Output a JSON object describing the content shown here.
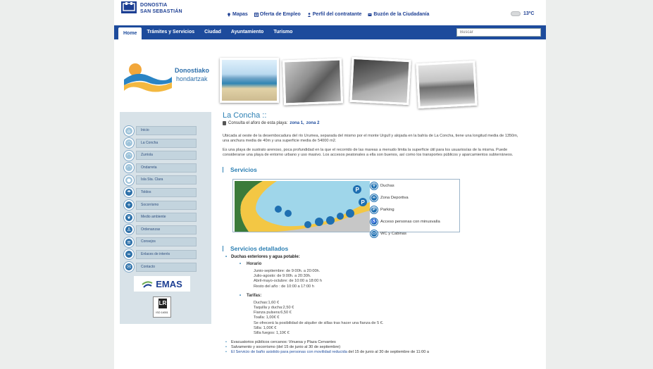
{
  "header": {
    "logo_line1": "DONOSTIA",
    "logo_line2": "SAN SEBASTIÁN",
    "links": [
      {
        "label": "Mapas",
        "icon": "map-pin-icon"
      },
      {
        "label": "Oferta de Empleo",
        "icon": "document-icon"
      },
      {
        "label": "Perfil del contratante",
        "icon": "person-icon"
      },
      {
        "label": "Buzón de la Ciudadanía",
        "icon": "mailbox-icon"
      }
    ],
    "weather": {
      "temp": "13ºC",
      "icon": "cloud-icon"
    }
  },
  "nav": {
    "tabs": [
      "Home",
      "Trámites y Servicios",
      "Ciudad",
      "Ayuntamiento",
      "Turismo"
    ],
    "active_index": 0,
    "search_placeholder": "Buscar"
  },
  "sidebar": {
    "brand_line1": "Donostiako",
    "brand_line2": "hondartzak",
    "menu": [
      {
        "label": "Inicio",
        "icon": "home-icon"
      },
      {
        "label": "La Concha",
        "icon": "beach-icon"
      },
      {
        "label": "Zurriola",
        "icon": "beach-icon"
      },
      {
        "label": "Ondarreta",
        "icon": "beach-icon"
      },
      {
        "label": "Isla Sta. Clara",
        "icon": "island-icon"
      },
      {
        "label": "Toldos",
        "icon": "umbrella-icon"
      },
      {
        "label": "Socorrismo",
        "icon": "cross-icon"
      },
      {
        "label": "Medio ambiente",
        "icon": "leaf-icon"
      },
      {
        "label": "Ordenanzas",
        "icon": "person-icon"
      },
      {
        "label": "Consejos",
        "icon": "list-icon"
      },
      {
        "label": "Enlaces de interés",
        "icon": "link-icon"
      },
      {
        "label": "Contacto",
        "icon": "mail-icon"
      }
    ],
    "emas_label": "EMAS",
    "iso_label": "ISO 14001"
  },
  "content": {
    "title": "La Concha ::",
    "aforo_text": "Consulta el aforo de esta playa:",
    "aforo_links": [
      "zona 1,",
      "zona 2"
    ],
    "para1": "Ubicada al oeste de la desembocadura del río Urumea, separada del mismo por el monte Urgull y alojada en la bahía de La Concha, tiene una longitud media de 1350m, una anchura media de 40m y una superficie media de 54000 m2.",
    "para2": "Es una playa de sustrato arenoso, poca profundidad en la que el recorrido de las mareas a menudo limita la superficie útil para los usuarios/as de la misma. Puede considerarse una playa de entorno urbano y uso masivo. Los accesos peatonales a ella son buenos, así como los transportes públicos y aparcamientos subterráneos.",
    "services_title": "Servicios",
    "legend": [
      {
        "label": "Duchas",
        "glyph": "⚲"
      },
      {
        "label": "Zona Deportiva",
        "glyph": "∞"
      },
      {
        "label": "Parking",
        "glyph": "P"
      },
      {
        "label": "Acceso personas con minusvalía",
        "glyph": "♿"
      },
      {
        "label": "WC y Cabinas",
        "glyph": "▭"
      }
    ],
    "detailed_title": "Servicios detallados",
    "duchas_title": "Duchas exteriores y agua potable:",
    "horario_title": "Horario",
    "horario_lines": [
      "Junio-septiembre: de 9:00h. a 20:00h.",
      "Julio-agosto: de 9:00h. a 20:30h.",
      "Abril-mayo-octubre: de 10:00 a 18:00 h",
      "Resto del año : de 10:00 a 17:00 h"
    ],
    "tarifas_title": "Tarifas:",
    "tarifas_lines": [
      "Duchas:1,60 €",
      "Taquilla y ducha:2,50 €",
      "Fianza pulsera:6,50 €",
      "Toalla: 1,00€ €",
      "Se ofrecerá la posibilidad de alquiler de sillas tras hacer una fianza de 5 €.",
      "Silla: 1,00€ €",
      "Silla fuegos: 1,10€ €"
    ],
    "bottom_items": [
      "Evacuatorios públicos cercanos: Vinuesa y Plaza Cervantes",
      "Salvamento y socorrismo (del 15 de junio al 30 de septiembre)"
    ],
    "last_item_link": "El Servicio de baño asistido para personas con movilidad reducida",
    "last_item_rest": " del 15 de junio al 30 de septiembre de 11:00 a"
  }
}
